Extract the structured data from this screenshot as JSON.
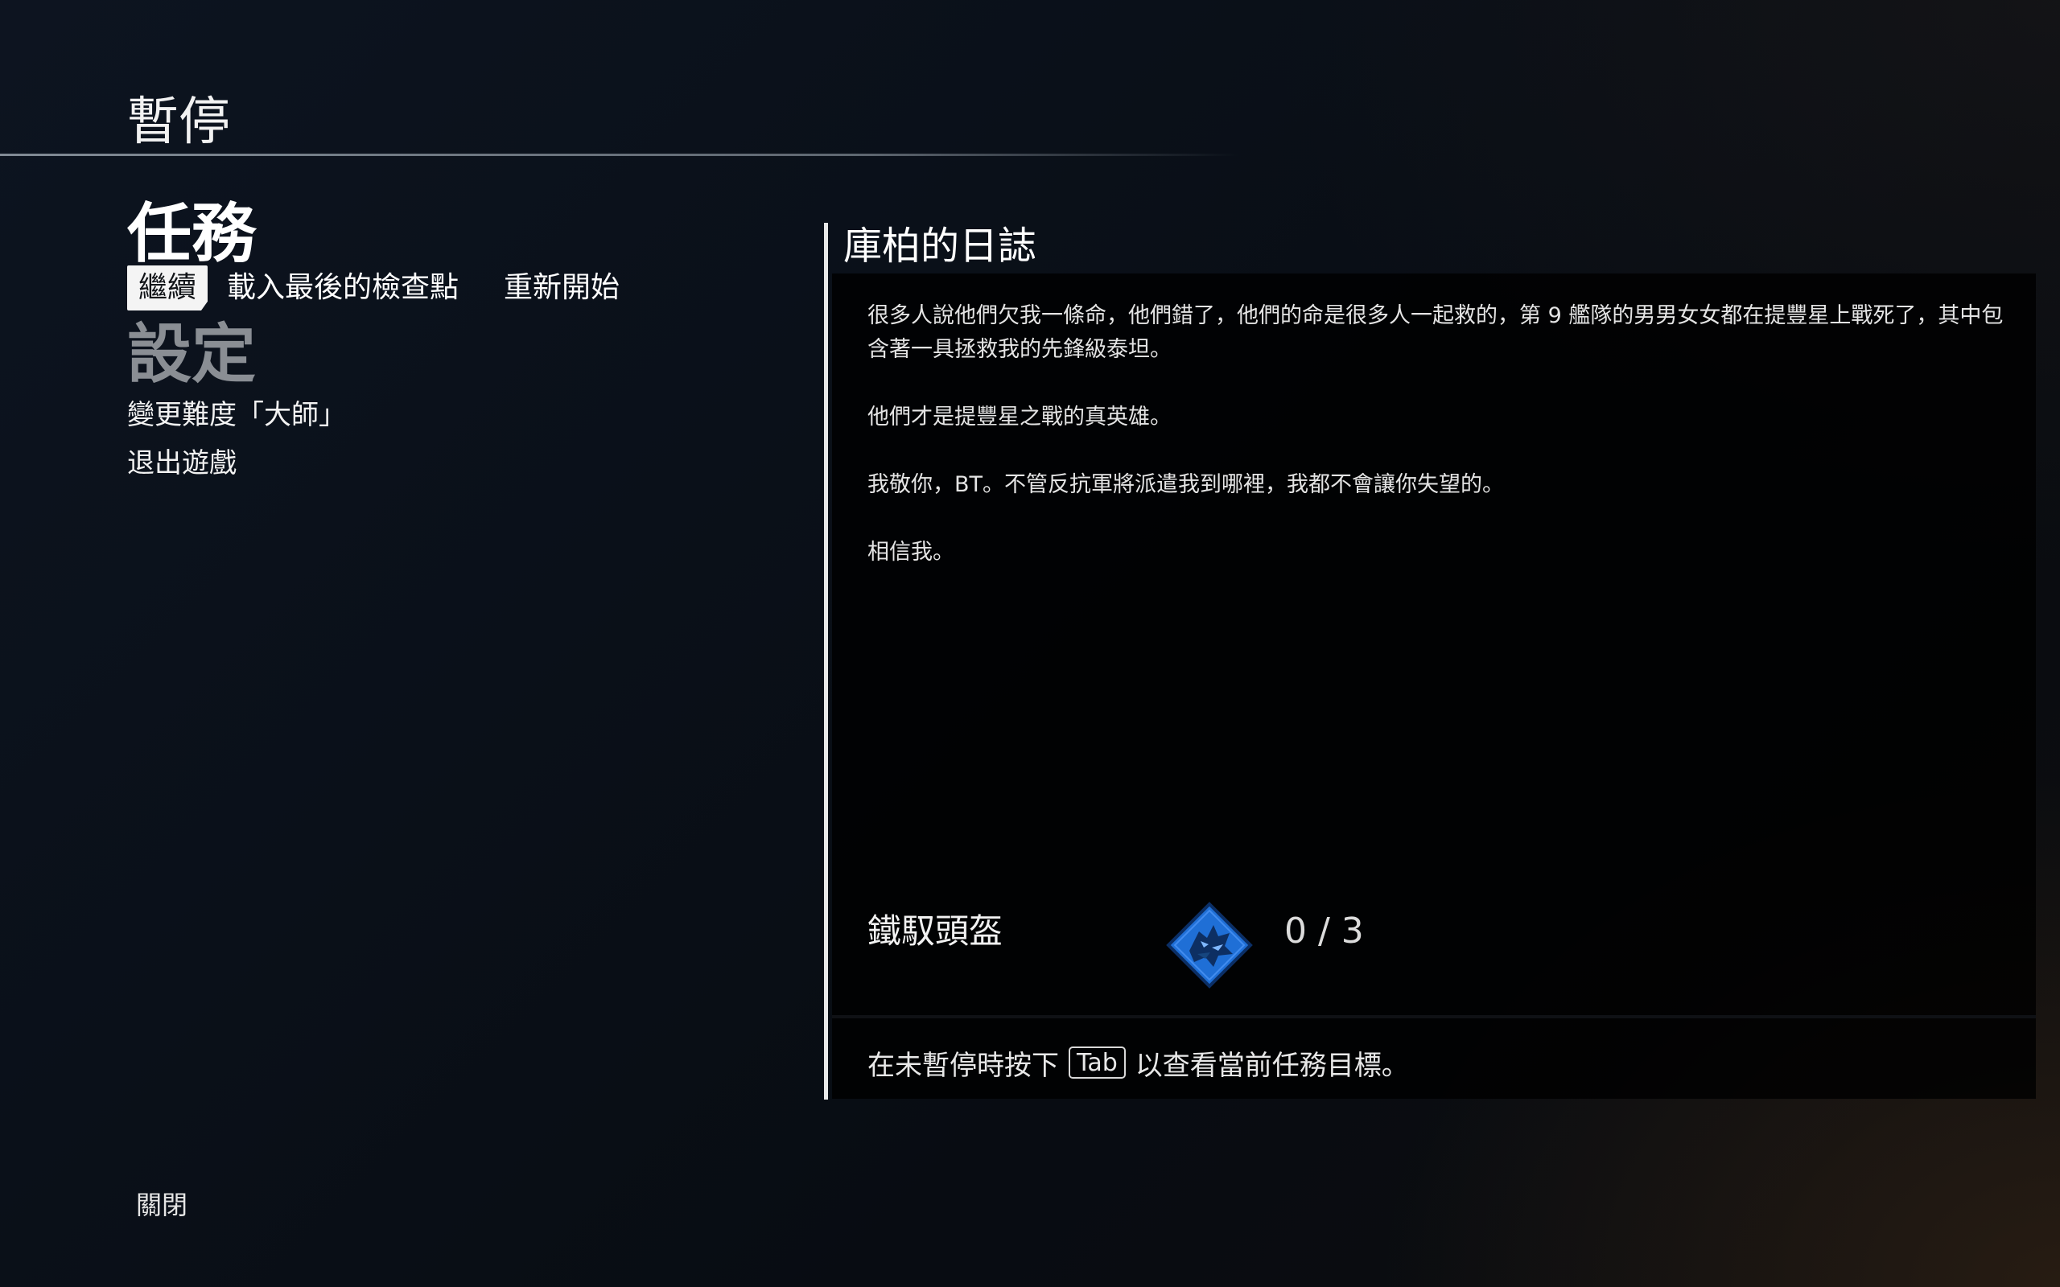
{
  "header": {
    "title": "暫停"
  },
  "mission": {
    "heading": "任務",
    "actions": [
      {
        "label": "繼續",
        "selected": true
      },
      {
        "label": "載入最後的檢查點",
        "selected": false
      },
      {
        "label": "重新開始",
        "selected": false
      }
    ]
  },
  "settings": {
    "heading": "設定",
    "items": [
      {
        "label": "變更難度「大師」"
      },
      {
        "label": "退出遊戲"
      }
    ]
  },
  "footer": {
    "close_label": "關閉"
  },
  "log": {
    "title": "庫柏的日誌",
    "paragraphs": [
      "很多人說他們欠我一條命，他們錯了，他們的命是很多人一起救的，第 9 艦隊的男男女女都在提豐星上戰死了，其中包含著一具拯救我的先鋒級泰坦。",
      "他們才是提豐星之戰的真英雄。",
      "我敬你，BT。不管反抗軍將派遣我到哪裡，我都不會讓你失望的。",
      "相信我。"
    ]
  },
  "collectible": {
    "name": "鐵馭頭盔",
    "icon": "helmet-emblem-icon",
    "count_text": "0 / 3",
    "found": 0,
    "total": 3,
    "accent_color": "#1f6fd6"
  },
  "hint": {
    "before": "在未暫停時按下",
    "key": "Tab",
    "after": "以查看當前任務目標。"
  }
}
